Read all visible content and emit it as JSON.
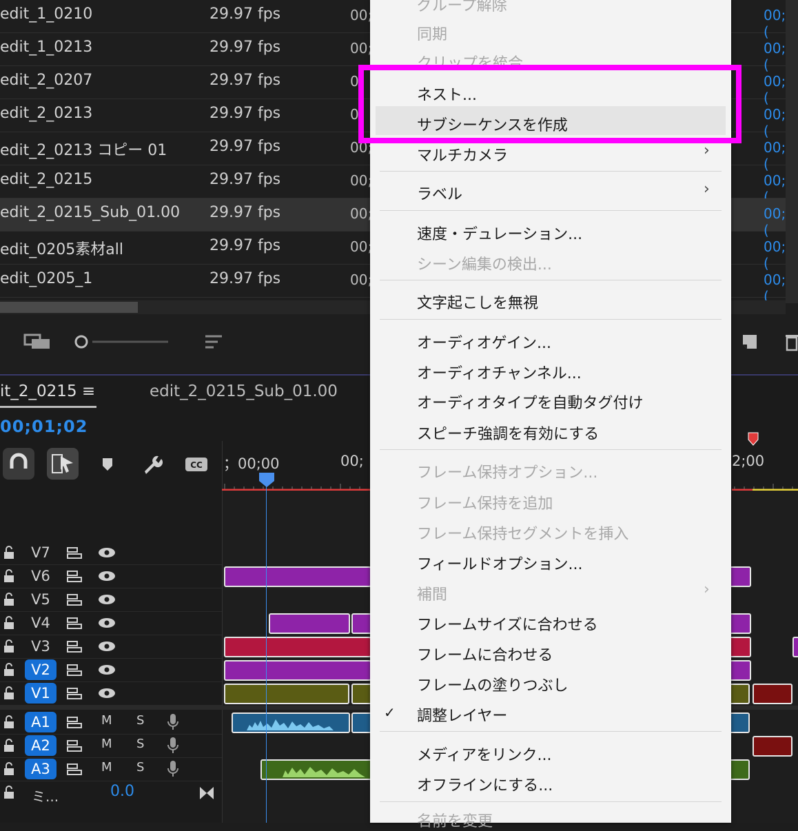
{
  "project_list": {
    "rows": [
      {
        "name": "edit_1_0210",
        "fps": "29.97 fps",
        "tc": "00;",
        "tc2": "00;("
      },
      {
        "name": "edit_1_0213",
        "fps": "29.97 fps",
        "tc": "00;",
        "tc2": "00;("
      },
      {
        "name": "edit_2_0207",
        "fps": "29.97 fps",
        "tc": "0",
        "tc2": "00;("
      },
      {
        "name": "edit_2_0213",
        "fps": "29.97 fps",
        "tc": "0",
        "tc2": "00;("
      },
      {
        "name": "edit_2_0213 コピー 01",
        "fps": "29.97 fps",
        "tc": "00;",
        "tc2": "00;("
      },
      {
        "name": "edit_2_0215",
        "fps": "29.97 fps",
        "tc": "00;",
        "tc2": "00;("
      },
      {
        "name": "edit_2_0215_Sub_01.00",
        "fps": "29.97 fps",
        "tc": "00;",
        "tc2": "00;("
      },
      {
        "name": "edit_0205素材all",
        "fps": "29.97 fps",
        "tc": "00;",
        "tc2": "00;("
      },
      {
        "name": "edit_0205_1",
        "fps": "29.97 fps",
        "tc": "00;",
        "tc2": "00;("
      }
    ]
  },
  "timeline": {
    "tabs": [
      "it_2_0215 ≡",
      "edit_2_0215_Sub_01.00"
    ],
    "timecode": "00;01;02",
    "ruler": [
      "；00;00",
      "00;",
      "2;00"
    ],
    "video_tracks": [
      "V7",
      "V6",
      "V5",
      "V4",
      "V3",
      "V2",
      "V1"
    ],
    "audio_tracks": [
      "A1",
      "A2",
      "A3"
    ],
    "audio_m": "M",
    "audio_s": "S",
    "mix_label": "ミ...",
    "mix_value": "0.0"
  },
  "menu": {
    "top_cut_1": "グループ解除",
    "sync": "同期",
    "top_cut_2": "クリップを統合",
    "nest": "ネスト...",
    "subsequence": "サブシーケンスを作成",
    "multicam": "マルチカメラ",
    "label": "ラベル",
    "speed": "速度・デュレーション...",
    "scene_detect": "シーン編集の検出...",
    "ignore_transcript": "文字起こしを無視",
    "audio_gain": "オーディオゲイン...",
    "audio_channels": "オーディオチャンネル...",
    "audio_autotag": "オーディオタイプを自動タグ付け",
    "speech_enhance": "スピーチ強調を有効にする",
    "frame_hold_opts": "フレーム保持オプション...",
    "add_frame_hold": "フレーム保持を追加",
    "insert_frame_hold": "フレーム保持セグメントを挿入",
    "field_options": "フィールドオプション...",
    "interpolation": "補間",
    "fit_frame_size": "フレームサイズに合わせる",
    "fit_frame": "フレームに合わせる",
    "fill_frame": "フレームの塗りつぶし",
    "adjustment_layer": "調整レイヤー",
    "link_media": "メディアをリンク...",
    "make_offline": "オフラインにする...",
    "rename_cut": "名前を変更",
    "chevron": "›",
    "check": "✓"
  },
  "colors": {
    "highlight": "#ff00ff",
    "accent": "#2d8ceb"
  }
}
